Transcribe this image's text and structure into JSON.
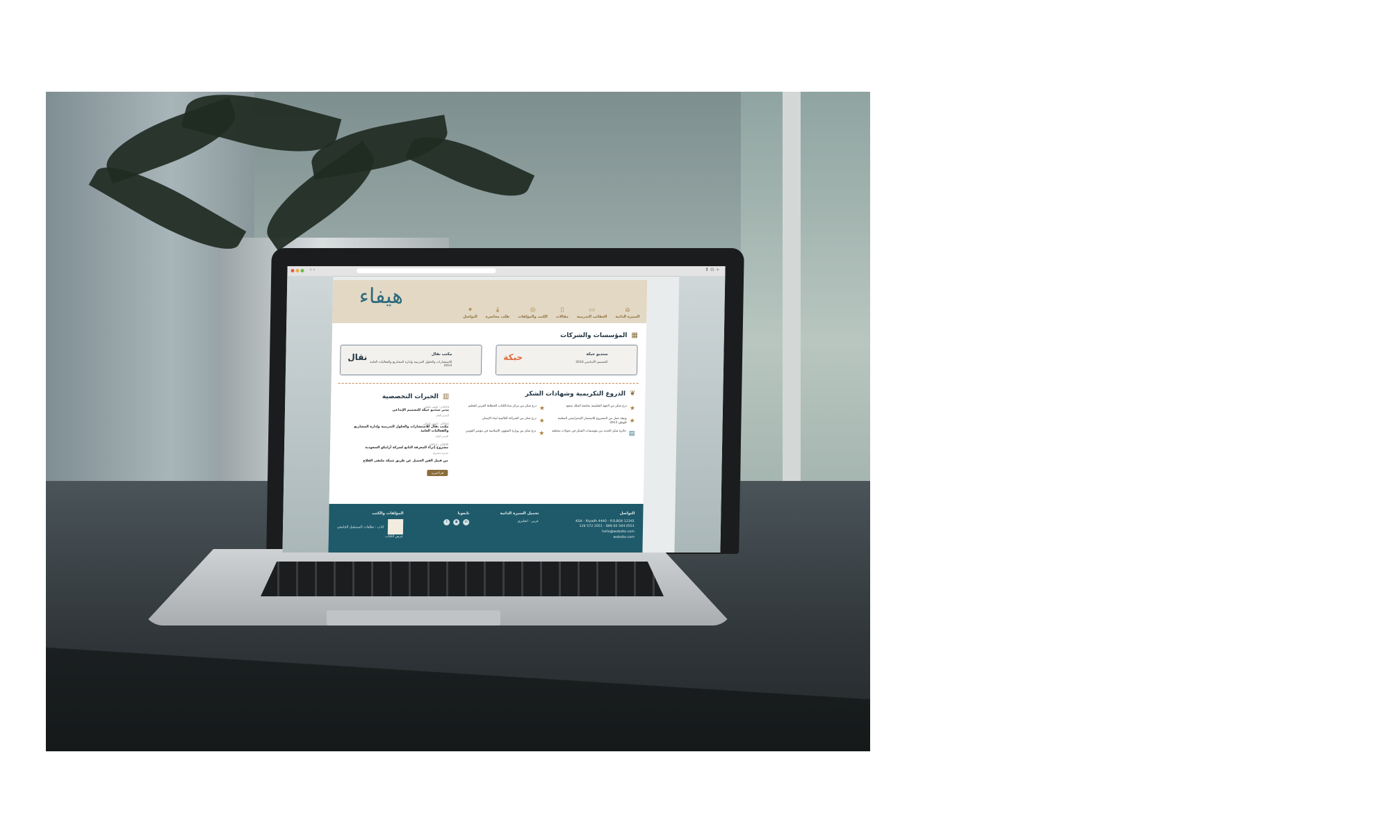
{
  "browser": {
    "url": ""
  },
  "logo": {
    "text": "هيفاء"
  },
  "nav": {
    "items": [
      {
        "label": "السيرة الذاتية",
        "icon": "building-icon"
      },
      {
        "label": "الحقائب التدريبية",
        "icon": "briefcase-icon"
      },
      {
        "label": "مقالات",
        "icon": "document-icon"
      },
      {
        "label": "الكتب والمؤلفات",
        "icon": "book-icon"
      },
      {
        "label": "طلب محاضرة",
        "icon": "download-icon"
      },
      {
        "label": "التواصل",
        "icon": "location-icon"
      }
    ]
  },
  "companies": {
    "title": "المؤسسات والشركات",
    "cards": [
      {
        "name": "ستديو حبكة",
        "desc": "للتصميم الأساسي 2016",
        "logo": "حبكة"
      },
      {
        "name": "مكتب نقال",
        "desc": "للاستشارات والحلول التدريبية وإدارة المشاريع والفعاليات العامة 2014",
        "logo": "نقال"
      }
    ]
  },
  "awards": {
    "title": "الدروع التكريمية وشهادات الشكر",
    "items": [
      {
        "text": "درع شكر من الجهة التعليمية بجامعة الملك سعود",
        "icon": "star-shield-icon"
      },
      {
        "text": "درع شكر من مركز مدادالكتاب للخطاط العربي للتعليم",
        "icon": "star-shield-icon"
      },
      {
        "text": "وثيقة عمل من المشروع للاستثمار الإستراتيجي المعلمة للوطن 2013",
        "icon": "star-shield-icon"
      },
      {
        "text": "درع شكر من الشراكة العالمية لبناء الإنسان",
        "icon": "star-shield-icon"
      },
      {
        "text": "جائزة شكر الحديد من مؤسسات الشكر في تحولات مختلفة",
        "icon": "certificate-icon"
      },
      {
        "text": "درع شكر من وزارة الشؤون الإسلامية في مؤتمر القوس",
        "icon": "star-shield-icon"
      }
    ]
  },
  "experiences": {
    "title": "الخبرات التخصصية",
    "items": [
      {
        "date": "2016م - الوقت الحالي",
        "title": "مدير ستديو حبكة للتصميم الإبداعي",
        "sub": "المدير العام"
      },
      {
        "date": "2014م - الوقت الحالي",
        "title": "مكتب نقال للاستشارات والحلول التدريبية وإدارة المشاريع والفعاليات العامة",
        "sub": "المدير العام"
      },
      {
        "date": "2009م - 2014م",
        "title": "مشروع إثراء المعرفة التابع لشركة أرامكو السعودية",
        "sub": "مديرة مشروع"
      },
      {
        "date": "",
        "title": "من قبيل الفن الجميل عن طريق شبكة ملتقى الفلاح",
        "sub": ""
      }
    ],
    "more": "اقرأ المزيد"
  },
  "footer": {
    "contact": {
      "title": "التواصل",
      "lines": [
        "KSA - Riyadh 4440 - P.O.BOX 12341",
        "0551 564 65 889 - 2051 572 126",
        "hello@website.com",
        "website.com"
      ]
    },
    "cv": {
      "title": "تحميل السيرة الذاتية",
      "options": [
        "عربي",
        "انجليزي"
      ]
    },
    "social": {
      "title": "تابعونا",
      "icons": [
        "twitter-icon",
        "instagram-icon",
        "linkedin-icon"
      ]
    },
    "books": {
      "title": "المؤلفات والكتب",
      "caption": "كتاب : تطلعات المستقبل الجامعي",
      "link": "عرض الكتاب"
    }
  }
}
